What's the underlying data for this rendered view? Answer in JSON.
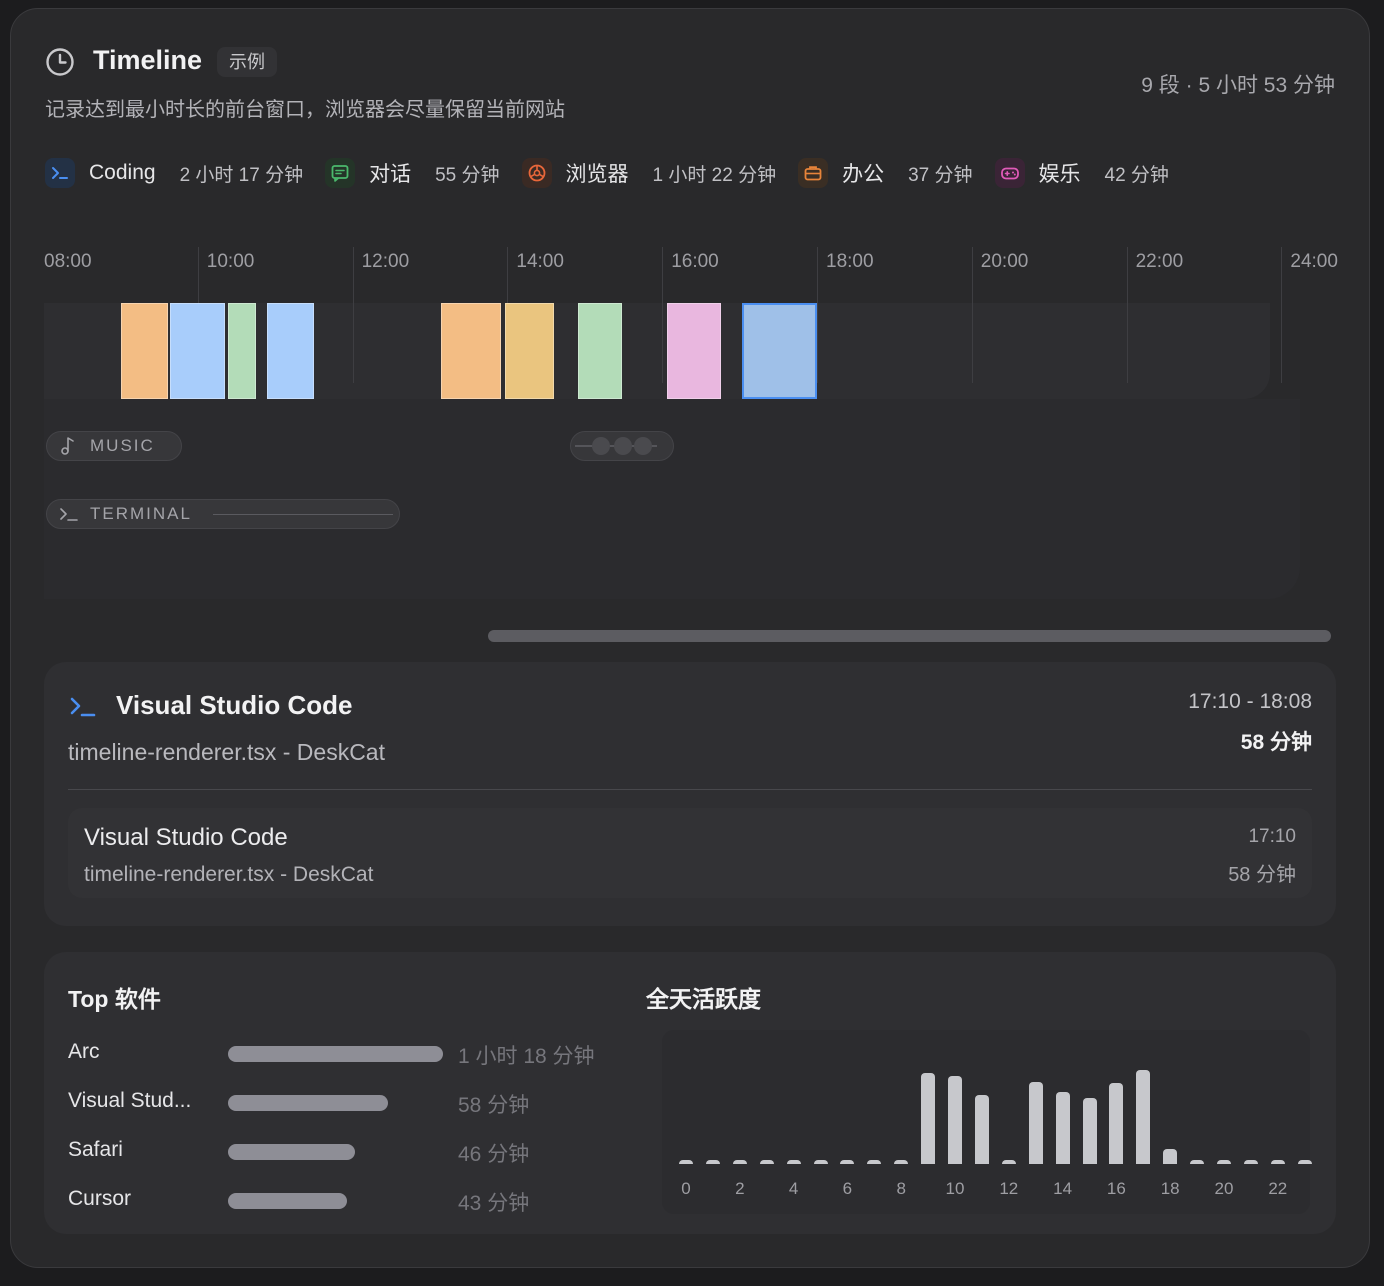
{
  "header": {
    "title": "Timeline",
    "badge": "示例",
    "subtitle": "记录达到最小时长的前台窗口，浏览器会尽量保留当前网站",
    "summary": "9 段 · 5 小时 53 分钟"
  },
  "categories": [
    {
      "icon": "terminal-icon",
      "name": "Coding",
      "duration": "2 小时 17 分钟",
      "color": "#4a8ef0",
      "bg": "#233145"
    },
    {
      "icon": "chat-icon",
      "name": "对话",
      "duration": "55 分钟",
      "color": "#4bb86c",
      "bg": "#243428"
    },
    {
      "icon": "browser-icon",
      "name": "浏览器",
      "duration": "1 小时 22 分钟",
      "color": "#e8673a",
      "bg": "#3a2a24"
    },
    {
      "icon": "briefcase-icon",
      "name": "办公",
      "duration": "37 分钟",
      "color": "#e8843a",
      "bg": "#3a2e24"
    },
    {
      "icon": "gamepad-icon",
      "name": "娱乐",
      "duration": "42 分钟",
      "color": "#e05ab8",
      "bg": "#3a2436"
    }
  ],
  "timeline": {
    "hours": [
      "08:00",
      "10:00",
      "12:00",
      "14:00",
      "16:00",
      "18:00",
      "20:00",
      "22:00",
      "24:00"
    ],
    "segments": [
      {
        "start": "09:00",
        "end": "09:36",
        "color": "#f3bd84"
      },
      {
        "start": "09:38",
        "end": "10:20",
        "color": "#a8cdfb"
      },
      {
        "start": "10:23",
        "end": "10:44",
        "color": "#b3dcb8"
      },
      {
        "start": "10:53",
        "end": "11:29",
        "color": "#a8cdfb"
      },
      {
        "start": "13:08",
        "end": "13:54",
        "color": "#f3bd84"
      },
      {
        "start": "13:57",
        "end": "14:35",
        "color": "#eac57f"
      },
      {
        "start": "14:54",
        "end": "15:28",
        "color": "#b3dcb8"
      },
      {
        "start": "16:03",
        "end": "16:45",
        "color": "#e9b7df"
      },
      {
        "start": "17:01",
        "end": "17:59",
        "color": "#9fc0e8",
        "selected": true
      }
    ],
    "lanes": [
      {
        "icon": "music-note-icon",
        "label": "MUSIC"
      },
      {
        "icon": "terminal-icon",
        "label": "TERMINAL"
      }
    ]
  },
  "detail": {
    "app": "Visual Studio Code",
    "window": "timeline-renderer.tsx - DeskCat",
    "range": "17:10 - 18:08",
    "duration": "58 分钟",
    "items": [
      {
        "app": "Visual Studio Code",
        "window": "timeline-renderer.tsx - DeskCat",
        "time": "17:10",
        "duration": "58 分钟"
      }
    ]
  },
  "top_apps": {
    "title": "Top 软件",
    "apps": [
      {
        "name": "Arc",
        "duration": "1 小时 18 分钟",
        "minutes": 78
      },
      {
        "name": "Visual Stud...",
        "duration": "58 分钟",
        "minutes": 58
      },
      {
        "name": "Safari",
        "duration": "46 分钟",
        "minutes": 46
      },
      {
        "name": "Cursor",
        "duration": "43 分钟",
        "minutes": 43
      }
    ]
  },
  "activity": {
    "title": "全天活跃度",
    "ticks": [
      "0",
      "2",
      "4",
      "6",
      "8",
      "10",
      "12",
      "14",
      "16",
      "18",
      "20",
      "22"
    ],
    "chart_data": {
      "type": "bar",
      "x": [
        0,
        1,
        2,
        3,
        4,
        5,
        6,
        7,
        8,
        9,
        10,
        11,
        12,
        13,
        14,
        15,
        16,
        17,
        18,
        19,
        20,
        21,
        22,
        23
      ],
      "values": [
        0,
        0,
        0,
        0,
        0,
        0,
        0,
        0,
        0,
        0.97,
        0.94,
        0.73,
        0,
        0.87,
        0.77,
        0.7,
        0.86,
        1.0,
        0.16,
        0,
        0,
        0,
        0,
        0
      ],
      "xlabel": "",
      "ylabel": ""
    }
  }
}
